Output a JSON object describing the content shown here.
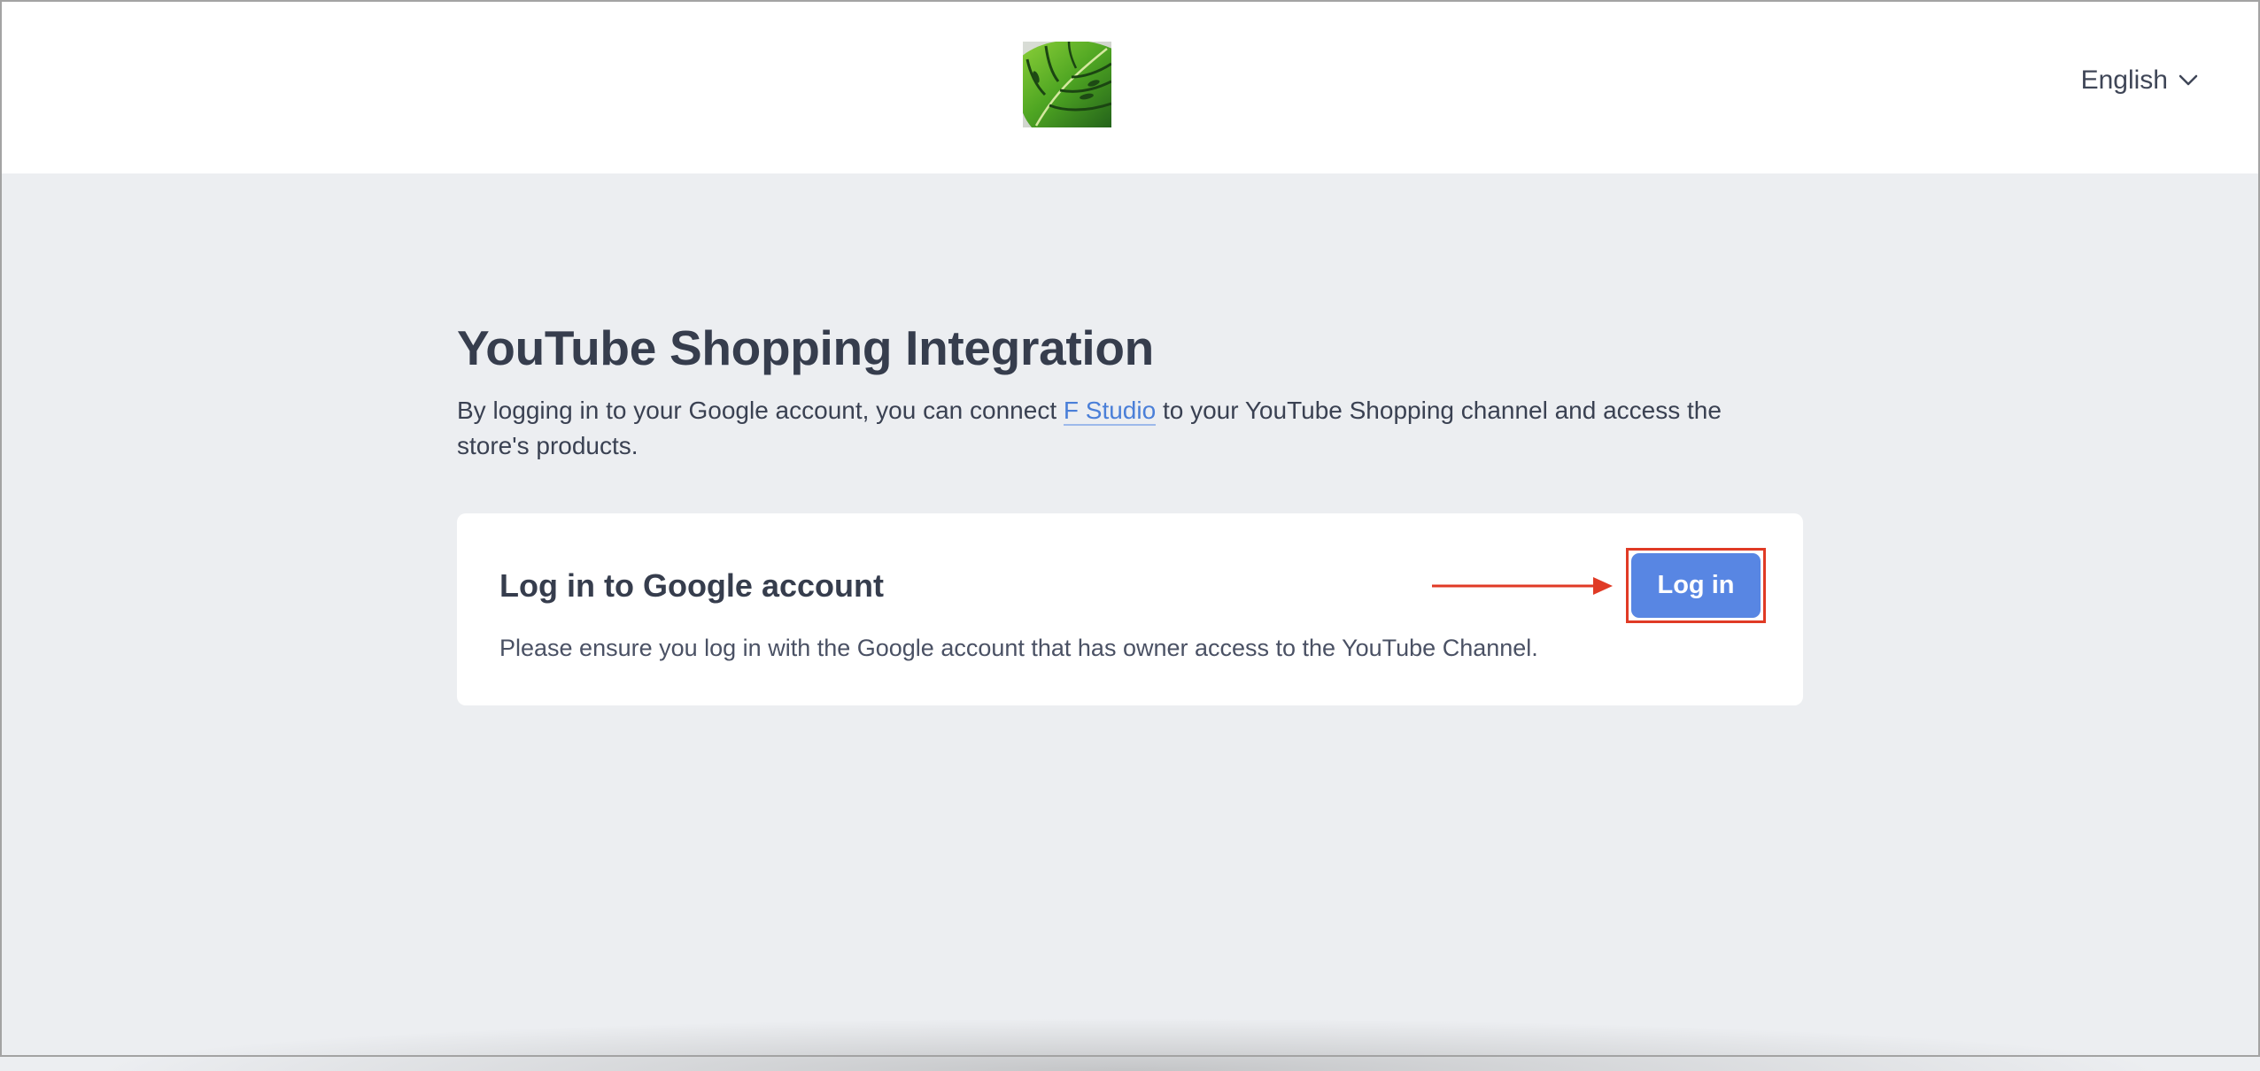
{
  "header": {
    "logo_icon": "monstera-leaf-logo",
    "language": {
      "selected": "English",
      "icon": "chevron-down-icon"
    }
  },
  "main": {
    "title": "YouTube Shopping Integration",
    "description_before_link": "By logging in to your Google account, you can connect ",
    "store_link": "F Studio",
    "description_after_link": " to your YouTube Shopping channel and access the store's products."
  },
  "login_card": {
    "title": "Log in to Google account",
    "note": "Please ensure you log in with the Google account that has owner access to the YouTube Channel.",
    "button_label": "Log in",
    "annotation_color": "#e03a25"
  },
  "colors": {
    "accent": "#5886e3",
    "link": "#4a7fd8",
    "background": "#eceef1",
    "text": "#363d4d"
  }
}
